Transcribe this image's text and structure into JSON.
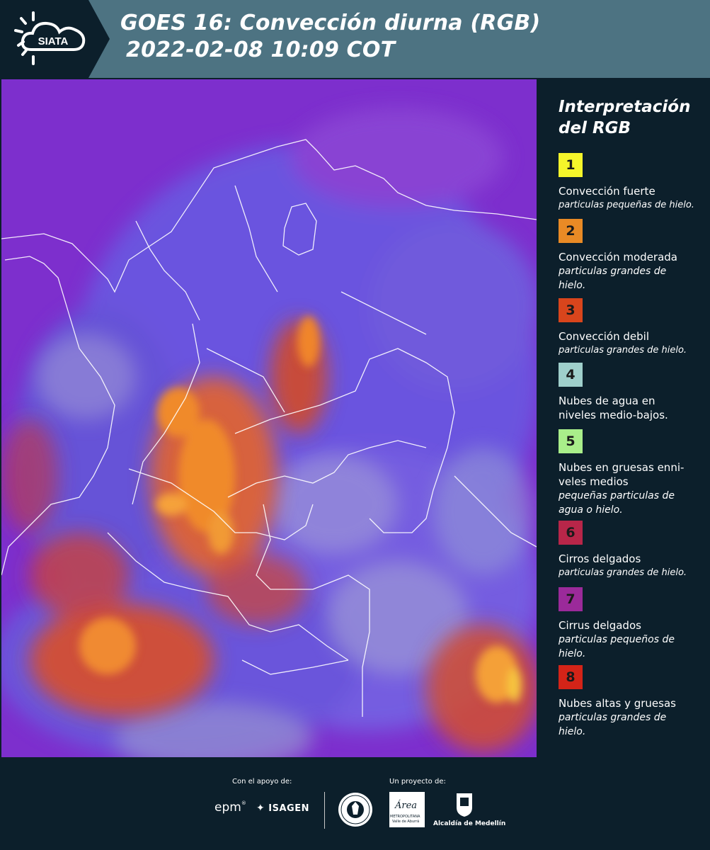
{
  "header": {
    "logo_text": "SIATA",
    "title_line1": "GOES 16: Convección diurna (RGB)",
    "title_line2": "2022-02-08 10:09 COT"
  },
  "legend": {
    "title_line1": "Interpretación",
    "title_line2": "del RGB",
    "items": [
      {
        "number": "1",
        "color": "#f5f52a",
        "label": "Convección fuerte",
        "sub": "particulas pequeñas de hielo."
      },
      {
        "number": "2",
        "color": "#e98a25",
        "label": "Convección moderada",
        "sub": "particulas grandes de hielo."
      },
      {
        "number": "3",
        "color": "#d9451c",
        "label": "Convección debil",
        "sub": "particulas grandes de hielo."
      },
      {
        "number": "4",
        "color": "#9fcfcb",
        "label": "Nubes de agua en niveles medio-bajos.",
        "sub": ""
      },
      {
        "number": "5",
        "color": "#a9ee8a",
        "label": "Nubes en gruesas enni-veles medios",
        "sub": "pequeñas particulas de agua o hielo."
      },
      {
        "number": "6",
        "color": "#b82649",
        "label": "Cirros delgados",
        "sub": "particulas grandes de hielo."
      },
      {
        "number": "7",
        "color": "#9b2a9a",
        "label": "Cirrus delgados",
        "sub": "particulas pequeños de hielo."
      },
      {
        "number": "8",
        "color": "#d42418",
        "label": "Nubes altas y gruesas",
        "sub": "particulas grandes de hielo."
      }
    ]
  },
  "footer": {
    "support_label": "Con el apoyo de:",
    "project_label": "Un proyecto de:",
    "sponsor_epm": "epm",
    "sponsor_isagen": "ISAGEN",
    "partner_area_main": "Área",
    "partner_area_sub1": "METROPOLITANA",
    "partner_area_sub2": "Valle de Aburrá",
    "partner_alcaldia": "Alcaldía de Medellín"
  }
}
